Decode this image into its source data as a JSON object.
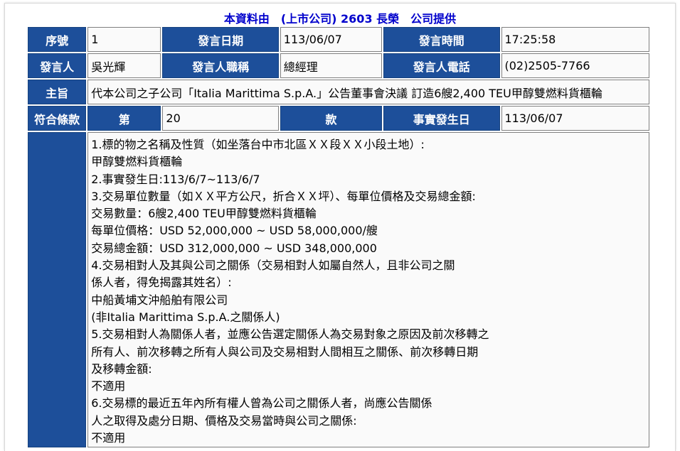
{
  "header": {
    "title": "本資料由　(上市公司) 2603 長榮　公司提供"
  },
  "row1": {
    "seq_label": "序號",
    "seq_value": "1",
    "date_label": "發言日期",
    "date_value": "113/06/07",
    "time_label": "發言時間",
    "time_value": "17:25:58"
  },
  "row2": {
    "speaker_label": "發言人",
    "speaker_value": "吳光輝",
    "title_label": "發言人職稱",
    "title_value": "總經理",
    "phone_label": "發言人電話",
    "phone_value": "(02)2505-7766"
  },
  "row3": {
    "subject_label": "主旨",
    "subject_value": "代本公司之子公司「Italia Marittima S.p.A.」公告董事會決議 訂造6艘2,400 TEU甲醇雙燃料貨櫃輪"
  },
  "row4": {
    "clause_label": "符合條款",
    "article_label": "第",
    "article_value": "20",
    "paragraph_label": "款",
    "event_date_label": "事實發生日",
    "event_date_value": "113/06/07"
  },
  "body_lines": [
    "1.標的物之名稱及性質（如坐落台中市北區ＸＸ段ＸＸ小段土地）:",
    "甲醇雙燃料貨櫃輪",
    "2.事實發生日:113/6/7~113/6/7",
    "3.交易單位數量（如ＸＸ平方公尺，折合ＸＸ坪）、每單位價格及交易總金額:",
    "交易數量：6艘2,400 TEU甲醇雙燃料貨櫃輪",
    "每單位價格：USD 52,000,000 ~ USD 58,000,000/艘",
    "交易總金額：USD 312,000,000 ~ USD 348,000,000",
    "4.交易相對人及其與公司之關係（交易相對人如屬自然人，且非公司之關",
    "係人者，得免揭露其姓名）:",
    "中船黃埔文沖船舶有限公司",
    "(非Italia Marittima S.p.A.之關係人)",
    "5.交易相對人為關係人者，並應公告選定關係人為交易對象之原因及前次移轉之",
    "所有人、前次移轉之所有人與公司及交易相對人間相互之關係、前次移轉日期",
    "及移轉金額:",
    "不適用",
    "6.交易標的最近五年內所有權人曾為公司之關係人者，尚應公告關係",
    "人之取得及處分日期、價格及交易當時與公司之關係:",
    "不適用"
  ],
  "colors": {
    "label_bg": "#1d4f9a",
    "header_text": "#0000cc"
  }
}
